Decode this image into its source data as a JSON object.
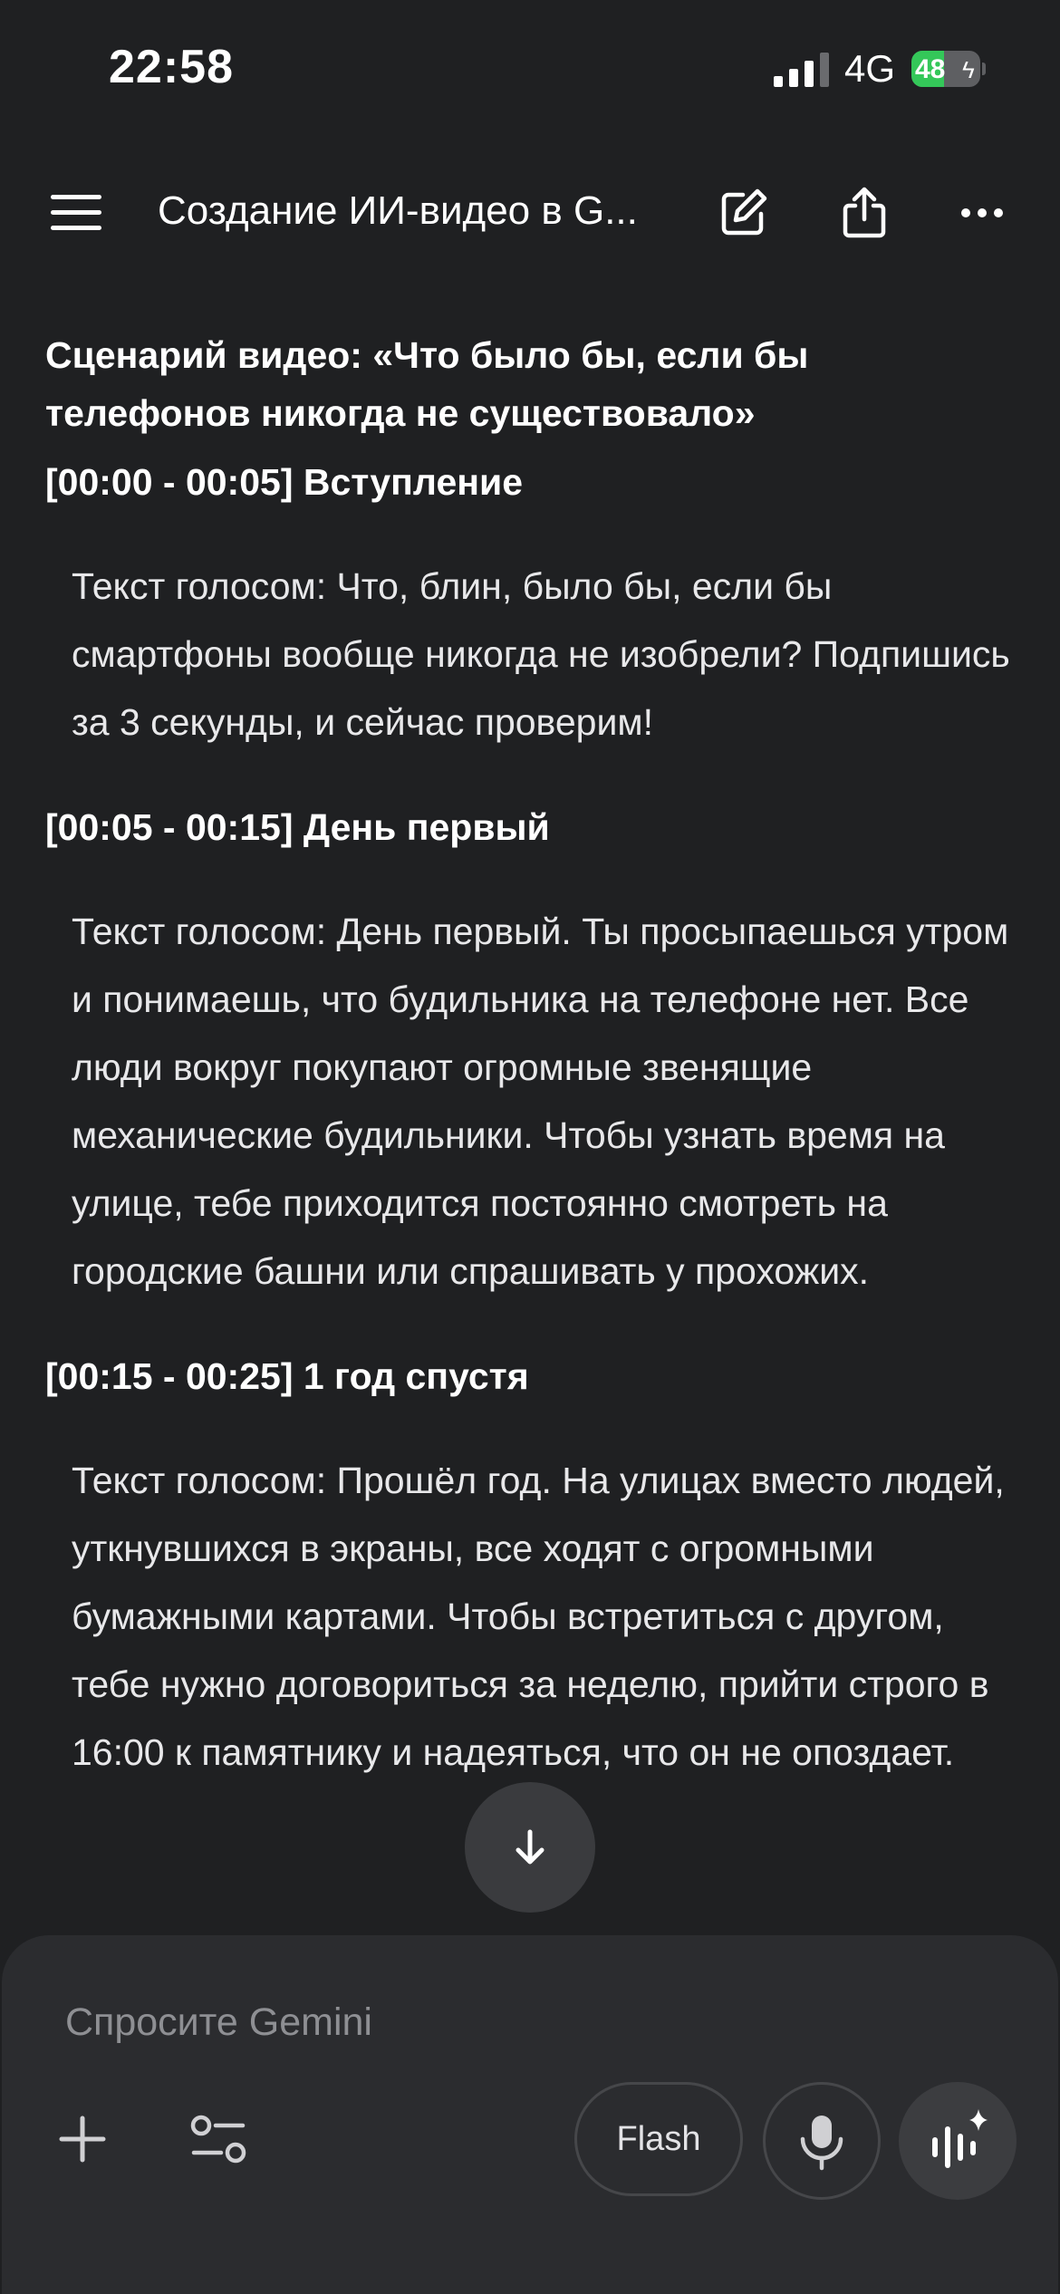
{
  "status_bar": {
    "time": "22:58",
    "network": "4G",
    "battery_percent": "48",
    "battery_level": 0.48,
    "battery_charging": true
  },
  "header": {
    "title": "Создание ИИ-видео в G...",
    "icons": [
      "menu-icon",
      "new-chat-icon",
      "share-icon",
      "more-icon"
    ]
  },
  "document": {
    "title": "Сценарий видео: «Что было бы, если бы телефонов никогда не существовало»",
    "sections": [
      {
        "heading": "[00:00 - 00:05] Вступление",
        "text": "Текст голосом: Что, блин, было бы, если бы смартфоны вообще никогда не изобрели? Подпишись за 3 секунды, и сейчас проверим!"
      },
      {
        "heading": "[00:05 - 00:15] День первый",
        "text": "Текст голосом: День первый. Ты просыпаешься утром и понимаешь, что будильника на телефоне нет. Все люди вокруг покупают огромные звенящие механические будильники. Чтобы узнать время на улице, тебе приходится постоянно смотреть на городские башни или спрашивать у прохожих."
      },
      {
        "heading": "[00:15 - 00:25] 1 год спустя",
        "text": "Текст голосом: Прошёл год. На улицах вместо людей, уткнувшихся в экраны, все ходят с огромными бумажными картами. Чтобы встретиться с другом, тебе нужно договориться за неделю, прийти строго в 16:00 к памятнику и надеяться, что он не опоздает."
      }
    ]
  },
  "composer": {
    "placeholder": "Спросите Gemini",
    "model_label": "Flash"
  }
}
